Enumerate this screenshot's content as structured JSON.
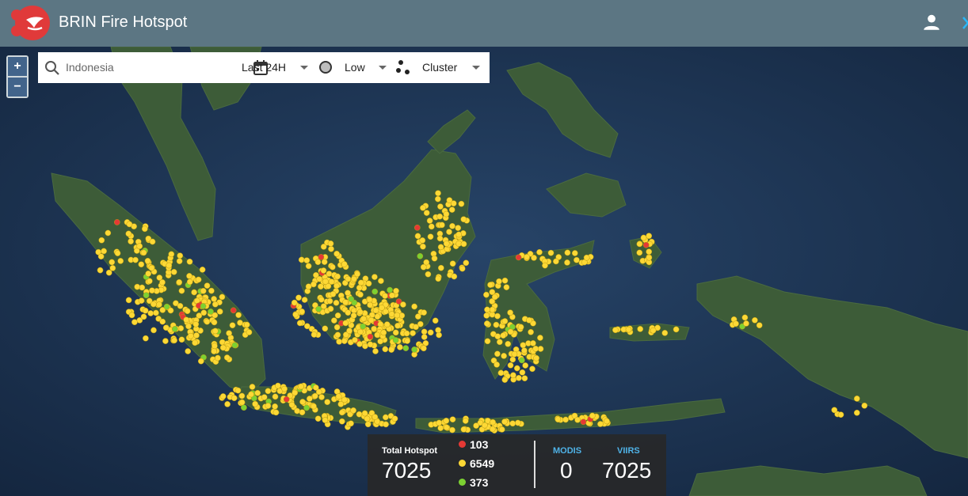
{
  "header": {
    "title": "BRIN Fire Hotspot"
  },
  "zoom": {
    "in_label": "+",
    "out_label": "−"
  },
  "toolbar": {
    "search_placeholder": "Indonesia",
    "time_range": "Last 24H",
    "confidence": "Low",
    "display_mode": "Cluster"
  },
  "stats": {
    "total_label": "Total Hotspot",
    "total_value": "7025",
    "high_count": "103",
    "medium_count": "6549",
    "low_count": "373",
    "modis_label": "MODIS",
    "modis_value": "0",
    "viirs_label": "VIIRS",
    "viirs_value": "7025"
  },
  "colors": {
    "header_bg": "#5c7683",
    "ocean": "#1a3050",
    "land": "#3d5c38",
    "hotspot_high": "#e53935",
    "hotspot_medium": "#fdd835",
    "hotspot_low": "#7cd132",
    "accent_blue": "#4fb3e8"
  }
}
